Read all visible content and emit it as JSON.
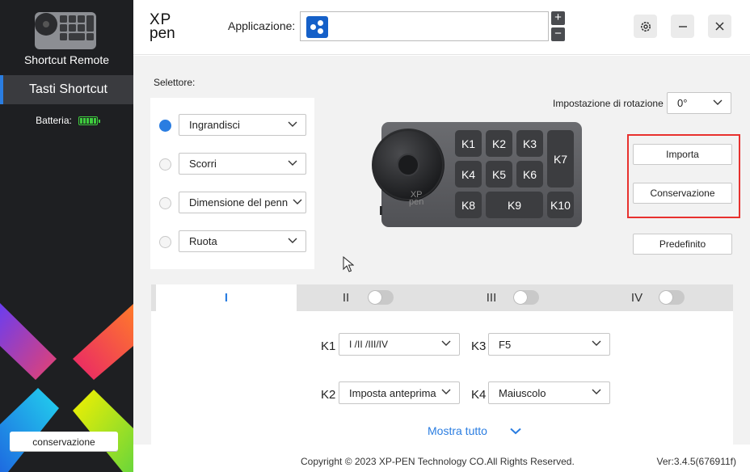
{
  "sidebar": {
    "device_name": "Shortcut Remote",
    "selected_item": "Tasti Shortcut",
    "battery_label": "Batteria:",
    "profile_button": "conservazione"
  },
  "header": {
    "logo_line1": "XP",
    "logo_line2": "pen",
    "app_label": "Applicazione:",
    "add_app": "+",
    "remove_app": "−"
  },
  "selector": {
    "label": "Selettore:",
    "options": [
      {
        "value": "Ingrandisci",
        "selected": true
      },
      {
        "value": "Scorri",
        "selected": false
      },
      {
        "value": "Dimensione del penn",
        "selected": false
      },
      {
        "value": "Ruota",
        "selected": false
      }
    ]
  },
  "rotation": {
    "label": "Impostazione di rotazione",
    "value": "0°"
  },
  "device_keys": [
    "K1",
    "K2",
    "K3",
    "K4",
    "K5",
    "K6",
    "K7",
    "K8",
    "K9",
    "K10"
  ],
  "device_logo": [
    "XP",
    "pen"
  ],
  "buttons": {
    "import": "Importa",
    "save": "Conservazione",
    "default": "Predefinito"
  },
  "tabs": [
    {
      "label": "I",
      "active": true
    },
    {
      "label": "II",
      "active": false
    },
    {
      "label": "III",
      "active": false
    },
    {
      "label": "IV",
      "active": false
    }
  ],
  "key_assignments": [
    {
      "key": "K1",
      "value": "I /II /III/IV"
    },
    {
      "key": "K3",
      "value": "F5"
    },
    {
      "key": "K2",
      "value": "Imposta anteprima"
    },
    {
      "key": "K4",
      "value": "Maiuscolo"
    }
  ],
  "show_all": "Mostra tutto",
  "footer": {
    "copyright": "Copyright © 2023  XP-PEN Technology CO.All Rights Reserved.",
    "version": "Ver:3.4.5(676911f)"
  },
  "colors": {
    "accent": "#2a7de1",
    "sidebar_bg": "#1e1f22",
    "highlight_frame": "#e8312e",
    "battery": "#3ecb3e"
  }
}
